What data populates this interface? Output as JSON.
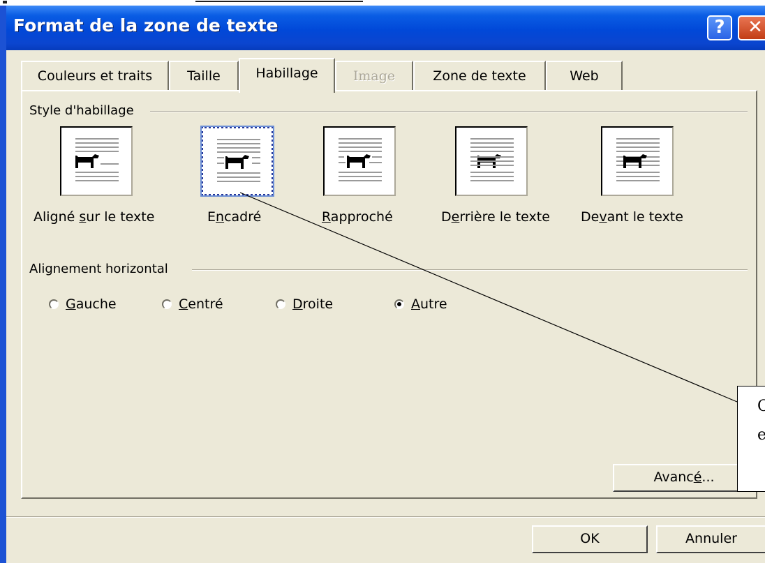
{
  "window": {
    "title": "Format de la zone de texte",
    "help_label": "?",
    "close_label": "✕"
  },
  "tabs": [
    {
      "label": "Couleurs et traits",
      "state": "normal"
    },
    {
      "label": "Taille",
      "state": "normal"
    },
    {
      "label": "Habillage",
      "state": "active"
    },
    {
      "label": "Image",
      "state": "disabled"
    },
    {
      "label": "Zone de texte",
      "state": "normal"
    },
    {
      "label": "Web",
      "state": "normal"
    }
  ],
  "wrap_style": {
    "group_label": "Style d'habillage",
    "options": [
      {
        "pre": "Aligné ",
        "key": "s",
        "post": "ur le texte",
        "icon": "inline-with-text-icon"
      },
      {
        "pre": "E",
        "key": "n",
        "post": "cadré",
        "icon": "square-wrap-icon",
        "selected": true
      },
      {
        "pre": "",
        "key": "R",
        "post": "approché",
        "icon": "tight-wrap-icon"
      },
      {
        "pre": "D",
        "key": "e",
        "post": "rrière le texte",
        "icon": "behind-text-icon"
      },
      {
        "pre": "De",
        "key": "v",
        "post": "ant le texte",
        "icon": "in-front-of-text-icon"
      }
    ]
  },
  "horizontal_alignment": {
    "group_label": "Alignement horizontal",
    "options": [
      {
        "pre": "",
        "key": "G",
        "post": "auche",
        "checked": false
      },
      {
        "pre": "",
        "key": "C",
        "post": "entré",
        "checked": false
      },
      {
        "pre": "",
        "key": "D",
        "post": "roite",
        "checked": false
      },
      {
        "pre": "",
        "key": "A",
        "post": "utre",
        "checked": true
      }
    ]
  },
  "buttons": {
    "advanced": {
      "pre": "Avanc",
      "key": "é",
      "post": "..."
    },
    "ok": "OK",
    "cancel": "Annuler"
  },
  "callout": {
    "line1": "C",
    "line2": "e"
  }
}
